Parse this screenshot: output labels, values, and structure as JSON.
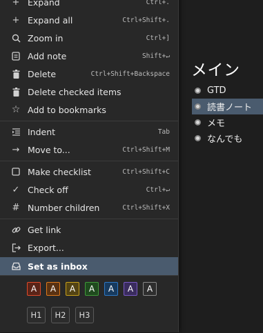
{
  "document": {
    "title": "メイン",
    "items": [
      {
        "label": "GTD"
      },
      {
        "label": "読書ノート"
      },
      {
        "label": "メモ"
      },
      {
        "label": "なんでも"
      }
    ]
  },
  "menu": {
    "items": [
      {
        "label": "Expand",
        "shortcut": "Ctrl+.",
        "icon": "plus-icon"
      },
      {
        "label": "Expand all",
        "shortcut": "Ctrl+Shift+.",
        "icon": "plus-icon"
      },
      {
        "label": "Zoom in",
        "shortcut": "Ctrl+]",
        "icon": "search-icon"
      },
      {
        "label": "Add note",
        "shortcut": "Shift+↵",
        "icon": "note-icon"
      },
      {
        "label": "Delete",
        "shortcut": "Ctrl+Shift+Backspace",
        "icon": "trash-icon"
      },
      {
        "label": "Delete checked items",
        "shortcut": "",
        "icon": "trash-icon"
      },
      {
        "label": "Add to bookmarks",
        "shortcut": "",
        "icon": "star-icon"
      },
      {
        "label": "Indent",
        "shortcut": "Tab",
        "icon": "indent-icon"
      },
      {
        "label": "Move to...",
        "shortcut": "Ctrl+Shift+M",
        "icon": "arrow-right-icon"
      },
      {
        "label": "Make checklist",
        "shortcut": "Ctrl+Shift+C",
        "icon": "checkbox-icon"
      },
      {
        "label": "Check off",
        "shortcut": "Ctrl+↵",
        "icon": "check-icon"
      },
      {
        "label": "Number children",
        "shortcut": "Ctrl+Shift+X",
        "icon": "hash-icon"
      },
      {
        "label": "Get link",
        "shortcut": "",
        "icon": "link-icon"
      },
      {
        "label": "Export...",
        "shortcut": "",
        "icon": "export-icon"
      },
      {
        "label": "Set as inbox",
        "shortcut": "",
        "icon": "inbox-icon"
      }
    ],
    "color_buttons": [
      {
        "label": "A",
        "color": "#e04a2a",
        "bg": "#5a2418"
      },
      {
        "label": "A",
        "color": "#e07a1a",
        "bg": "#5a3212"
      },
      {
        "label": "A",
        "color": "#c9a21a",
        "bg": "#544414"
      },
      {
        "label": "A",
        "color": "#3f9a3a",
        "bg": "#1f4a1e"
      },
      {
        "label": "A",
        "color": "#2e78c6",
        "bg": "#173a5e"
      },
      {
        "label": "A",
        "color": "#7a5ac6",
        "bg": "#3a2c5e"
      },
      {
        "label": "A",
        "color": "#8a8a8a",
        "bg": "#2e2e2e"
      }
    ],
    "heading_buttons": [
      {
        "label": "H1"
      },
      {
        "label": "H2"
      },
      {
        "label": "H3"
      }
    ]
  },
  "colors": {
    "menu_bg": "#282828",
    "highlight": "#4a5b6e",
    "background": "#1e1e1e"
  }
}
